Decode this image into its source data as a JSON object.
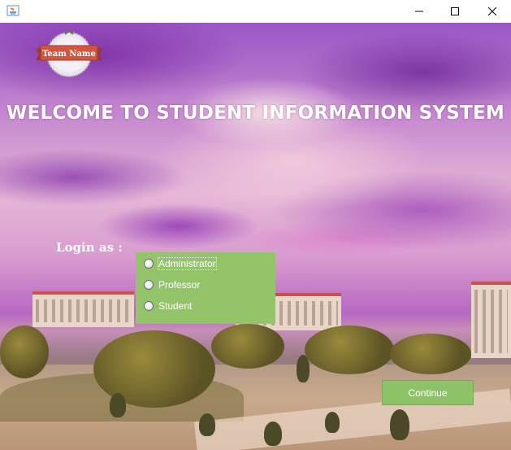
{
  "window": {
    "title": "",
    "controls": {
      "minimize_icon": "minimize-icon",
      "maximize_icon": "maximize-icon",
      "close_icon": "close-icon"
    }
  },
  "logo": {
    "text": "Team Name"
  },
  "heading": "WELCOME TO STUDENT INFORMATION SYSTEM",
  "login": {
    "label": "Login as :",
    "options": [
      {
        "label": "Administrator",
        "selected": false,
        "focused": true
      },
      {
        "label": "Professor",
        "selected": false,
        "focused": false
      },
      {
        "label": "Student",
        "selected": false,
        "focused": false
      }
    ],
    "panel_color": "#94c46a"
  },
  "continue_button": {
    "label": "Continue",
    "color": "#8dc267"
  },
  "colors": {
    "accent": "#1c6cd6",
    "heading_text": "#ffffff"
  }
}
